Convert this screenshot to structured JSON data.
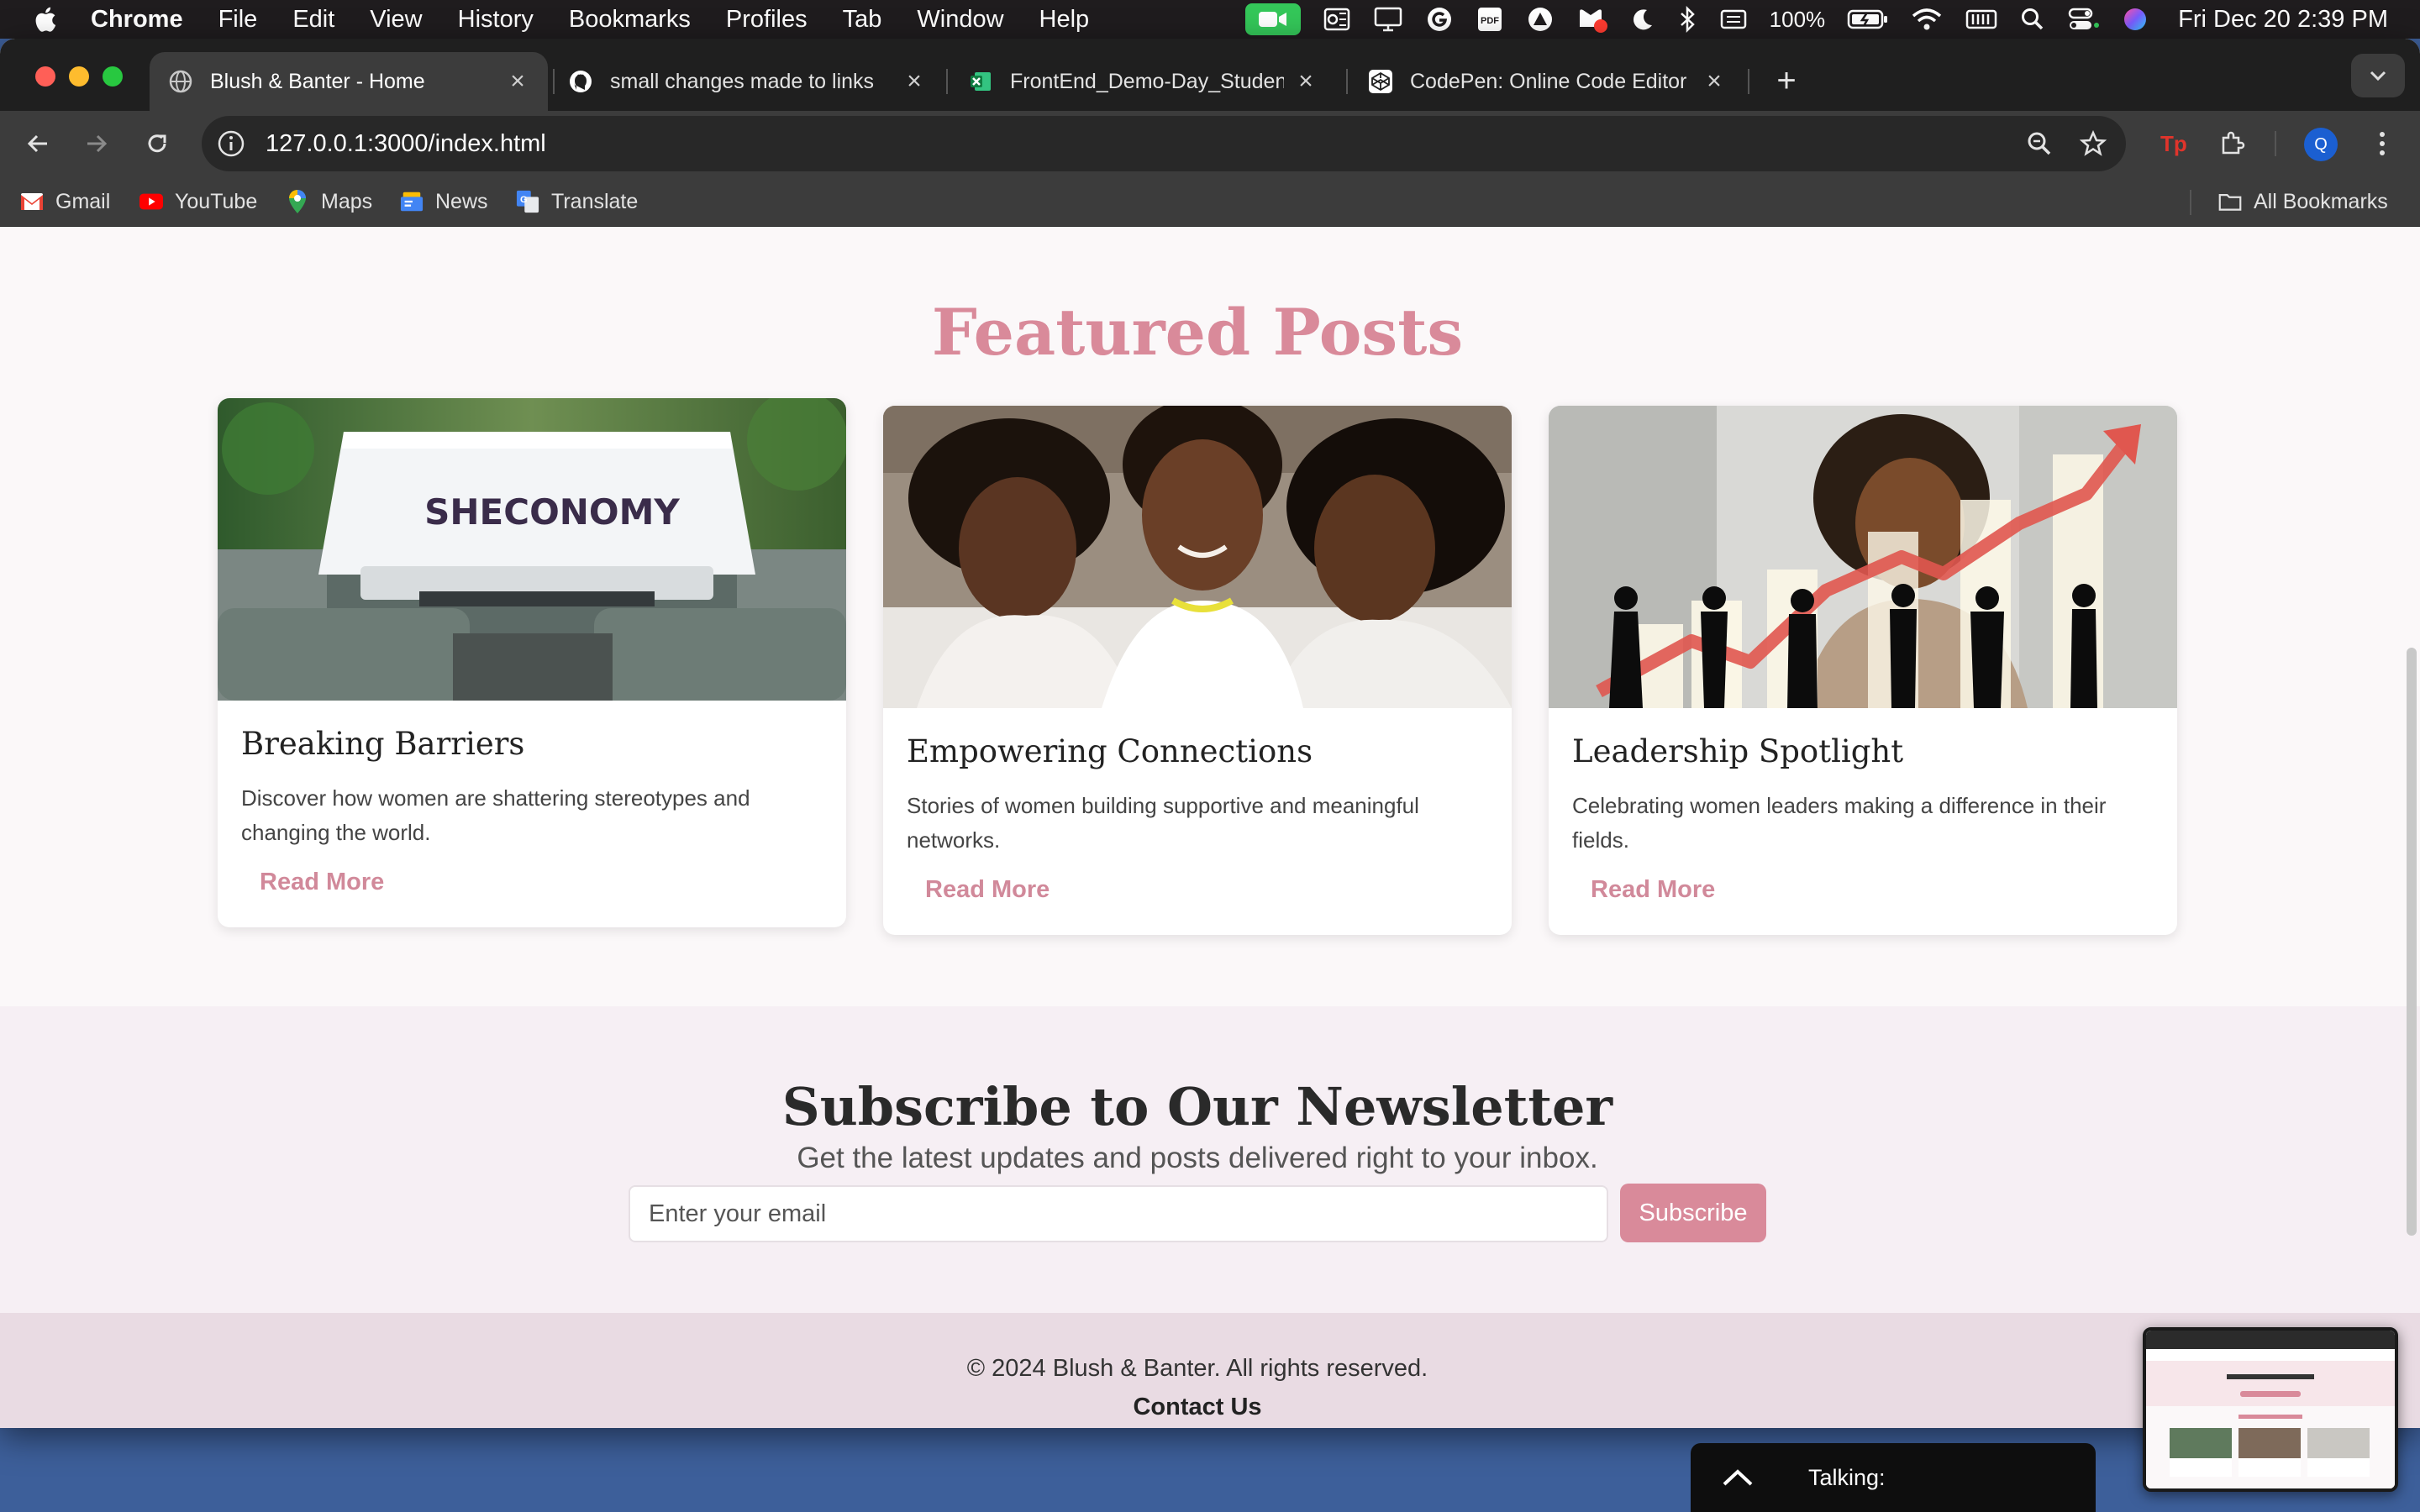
{
  "menubar": {
    "app_name": "Chrome",
    "menus": [
      "File",
      "Edit",
      "View",
      "History",
      "Bookmarks",
      "Profiles",
      "Tab",
      "Window",
      "Help"
    ],
    "battery": "100%",
    "clock": "Fri Dec 20  2:39 PM"
  },
  "tabs": [
    {
      "title": "Blush & Banter - Home",
      "icon": "globe-icon",
      "active": true
    },
    {
      "title": "small changes made to links",
      "icon": "github-icon",
      "active": false
    },
    {
      "title": "FrontEnd_Demo-Day_Student",
      "icon": "excel-icon",
      "active": false
    },
    {
      "title": "CodePen: Online Code Editor",
      "icon": "codepen-icon",
      "active": false
    }
  ],
  "address": {
    "url": "127.0.0.1:3000/index.html"
  },
  "profile_initial": "Q",
  "bookmarks": [
    {
      "label": "Gmail",
      "icon": "gmail-icon"
    },
    {
      "label": "YouTube",
      "icon": "youtube-icon"
    },
    {
      "label": "Maps",
      "icon": "maps-icon"
    },
    {
      "label": "News",
      "icon": "news-icon"
    },
    {
      "label": "Translate",
      "icon": "translate-icon"
    }
  ],
  "all_bookmarks": "All Bookmarks",
  "featured": {
    "title": "Featured Posts",
    "posts": [
      {
        "title": "Breaking Barriers",
        "text": "Discover how women are shattering stereotypes and changing the world.",
        "link": "Read More",
        "image_word": "SHECONOMY"
      },
      {
        "title": "Empowering Connections",
        "text": "Stories of women building supportive and meaningful networks.",
        "link": "Read More"
      },
      {
        "title": "Leadership Spotlight",
        "text": "Celebrating women leaders making a difference in their fields.",
        "link": "Read More"
      }
    ]
  },
  "newsletter": {
    "title": "Subscribe to Our Newsletter",
    "subtitle": "Get the latest updates and posts delivered right to your inbox.",
    "placeholder": "Enter your email",
    "button": "Subscribe"
  },
  "footer": {
    "copyright": "© 2024 Blush & Banter. All rights reserved.",
    "contact": "Contact Us"
  },
  "talking": {
    "label": "Talking:"
  },
  "colors": {
    "accent": "#d98a9a",
    "newsletter_bg": "#f6eff4",
    "footer_bg": "#e9dbe3"
  }
}
